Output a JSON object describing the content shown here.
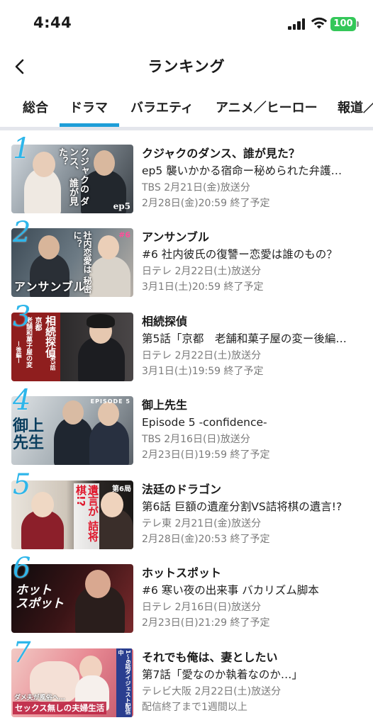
{
  "status": {
    "time": "4:44",
    "battery": "100"
  },
  "header": {
    "title": "ランキング"
  },
  "tabs": [
    {
      "label": "総合"
    },
    {
      "label": "ドラマ",
      "selected": true
    },
    {
      "label": "バラエティ"
    },
    {
      "label": "アニメ／ヒーロー"
    },
    {
      "label": "報道／"
    }
  ],
  "colors": {
    "accent": "#1e9ed8",
    "rank": "#2eb6ea",
    "subtext": "#7a7a7a",
    "battery": "#34c759"
  },
  "items": [
    {
      "rank": "1",
      "title": "クジャクのダンス、誰が見た？",
      "episode": "ep5 襲いかかる宿命ー秘められた弁護…",
      "broadcast": "TBS 2月21日(金)放送分",
      "end": "2月28日(金)20:59 終了予定",
      "thumb_text": [
        "クジャクの",
        "ダンス、",
        "誰が見た？"
      ],
      "thumb_tag": "ep5"
    },
    {
      "rank": "2",
      "title": "アンサンブル",
      "episode": "#6 社内彼氏の復讐ー恋愛は誰のもの？",
      "broadcast": "日テレ 2月22日(土)放送分",
      "end": "3月1日(土)20:59 終了予定",
      "thumb_text": [
        "社内恋愛は",
        "秘密に？"
      ],
      "thumb_logo": "アンサンブル",
      "thumb_tag": "#6"
    },
    {
      "rank": "3",
      "title": "相続探偵",
      "episode": "第5話「京都　老舗和菓子屋の変ー後編…",
      "broadcast": "日テレ 2月22日(土)放送分",
      "end": "3月1日(土)19:59 終了予定",
      "thumb_text": [
        "相続探偵",
        "京都",
        "老舗和菓子屋の変",
        "ー後編ー"
      ],
      "thumb_tag": "第5話"
    },
    {
      "rank": "4",
      "title": "御上先生",
      "episode": "Episode 5 -confidence-",
      "broadcast": "TBS 2月16日(日)放送分",
      "end": "2月23日(日)19:59 終了予定",
      "thumb_text": [
        "御上",
        "先生"
      ],
      "thumb_tag": "EPISODE 5"
    },
    {
      "rank": "5",
      "title": "法廷のドラゴン",
      "episode": "第6話 巨額の遺産分割VS詰将棋の遺言!?",
      "broadcast": "テレ東 2月21日(金)放送分",
      "end": "2月28日(金)20:53 終了予定",
      "thumb_text": [
        "遺言が",
        "詰将棋!?"
      ],
      "thumb_tag": "第6局"
    },
    {
      "rank": "6",
      "title": "ホットスポット",
      "episode": "#6 寒い夜の出来事 バカリズム脚本",
      "broadcast": "日テレ 2月16日(日)放送分",
      "end": "2月23日(日)21:29 終了予定",
      "thumb_text": [
        "ホット",
        "スポット"
      ]
    },
    {
      "rank": "7",
      "title": "それでも俺は、妻としたい",
      "episode": "第7話「愛なのか執着なのか…」",
      "broadcast": "テレビ大阪 2月22日(土)放送分",
      "end": "配信終了まで1週間以上",
      "thumb_text": [
        "ダメ夫が風俗へ…",
        "セックス無しの夫婦生活"
      ],
      "thumb_tag": "1〜6話ダイジェスト配信中"
    }
  ]
}
